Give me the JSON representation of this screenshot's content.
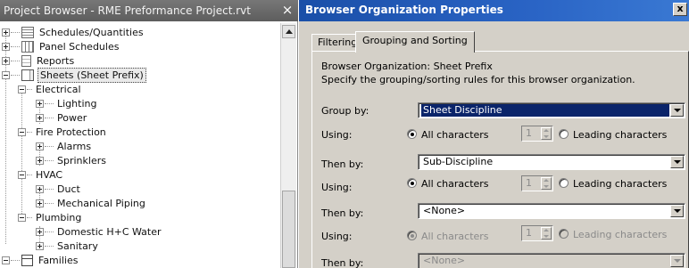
{
  "project_browser": {
    "title": "Project Browser - RME Preformance Project.rvt",
    "close_glyph": "×",
    "items": [
      {
        "label": "Schedules/Quantities",
        "icon": "schedule-icon",
        "expanded": false
      },
      {
        "label": "Panel Schedules",
        "icon": "panel-schedule-icon",
        "expanded": false
      },
      {
        "label": "Reports",
        "icon": "report-icon",
        "expanded": false
      },
      {
        "label": "Sheets (Sheet Prefix)",
        "icon": "sheet-icon",
        "expanded": true,
        "selected": true
      },
      {
        "label": "Electrical",
        "expanded": true
      },
      {
        "label": "Lighting",
        "expanded": false
      },
      {
        "label": "Power",
        "expanded": false
      },
      {
        "label": "Fire Protection",
        "expanded": true
      },
      {
        "label": "Alarms",
        "expanded": false
      },
      {
        "label": "Sprinklers",
        "expanded": false
      },
      {
        "label": "HVAC",
        "expanded": true
      },
      {
        "label": "Duct",
        "expanded": false
      },
      {
        "label": "Mechanical Piping",
        "expanded": false
      },
      {
        "label": "Plumbing",
        "expanded": true
      },
      {
        "label": "Domestic H+C Water",
        "expanded": false
      },
      {
        "label": "Sanitary",
        "expanded": false
      },
      {
        "label": "Families",
        "icon": "family-icon",
        "expanded": true
      }
    ]
  },
  "dialog": {
    "title": "Browser Organization Properties",
    "close_glyph": "x",
    "tabs": [
      {
        "label": "Filtering",
        "active": false
      },
      {
        "label": "Grouping and Sorting",
        "active": true
      }
    ],
    "heading": "Browser Organization: Sheet Prefix",
    "description": "Specify the grouping/sorting rules for this browser organization.",
    "rows": [
      {
        "label": "Group by:",
        "value": "Sheet Discipline",
        "highlighted": true,
        "enabled": true
      },
      {
        "label": "Using:",
        "all_chars": "All characters",
        "count": "1",
        "leading": "Leading characters",
        "enabled": true
      },
      {
        "label": "Then by:",
        "value": "Sub-Discipline",
        "enabled": true
      },
      {
        "label": "Using:",
        "all_chars": "All characters",
        "count": "1",
        "leading": "Leading characters",
        "enabled": true
      },
      {
        "label": "Then by:",
        "value": "<None>",
        "enabled": true
      },
      {
        "label": "Using:",
        "all_chars": "All characters",
        "count": "1",
        "leading": "Leading characters",
        "enabled": false
      },
      {
        "label": "Then by:",
        "value": "<None>",
        "enabled": false
      }
    ]
  }
}
